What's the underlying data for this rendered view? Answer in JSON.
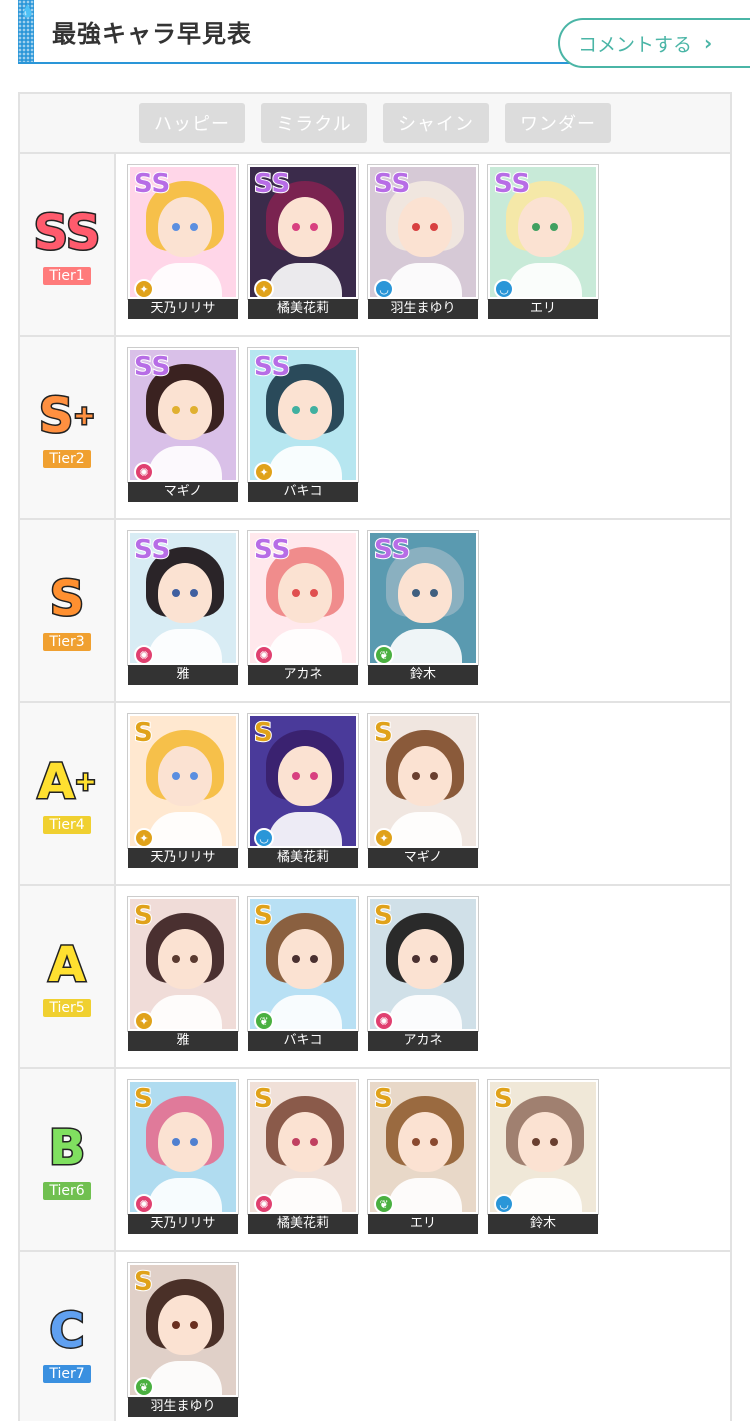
{
  "header": {
    "title": "最強キャラ早見表",
    "comment_label": "コメントする",
    "drop_glyph": "💧"
  },
  "filters": [
    "ハッピー",
    "ミラクル",
    "シャイン",
    "ワンダー"
  ],
  "tiers": [
    {
      "letter": "SS",
      "plus": "",
      "tier_label": "Tier1",
      "letter_color": "#ff5b6d",
      "badge_color": "#ff7b7b",
      "cards": [
        {
          "name": "天乃リリサ",
          "rarity": "SS",
          "attr": "happy",
          "attr_color": "#e0a21a",
          "hair": "#f6c04a",
          "eye": "#5b8fe0",
          "bg": "#ffd6e8"
        },
        {
          "name": "橘美花莉",
          "rarity": "SS",
          "attr": "happy",
          "attr_color": "#e0a21a",
          "hair": "#7a2350",
          "eye": "#d84080",
          "bg": "#3b2b4b"
        },
        {
          "name": "羽生まゆり",
          "rarity": "SS",
          "attr": "wonder",
          "attr_color": "#2a96d8",
          "hair": "#f0e6df",
          "eye": "#d84040",
          "bg": "#d6c9d6"
        },
        {
          "name": "エリ",
          "rarity": "SS",
          "attr": "wonder",
          "attr_color": "#2a96d8",
          "hair": "#f5e8a8",
          "eye": "#40a060",
          "bg": "#c8ead8"
        }
      ]
    },
    {
      "letter": "S",
      "plus": "+",
      "tier_label": "Tier2",
      "letter_color": "#ff9040",
      "badge_color": "#f0a030",
      "cards": [
        {
          "name": "マギノ",
          "rarity": "SS",
          "attr": "miracle",
          "attr_color": "#e04070",
          "hair": "#3a2220",
          "eye": "#e0b030",
          "bg": "#d9c0e8"
        },
        {
          "name": "バキコ",
          "rarity": "SS",
          "attr": "happy",
          "attr_color": "#e0a21a",
          "hair": "#2a4a5a",
          "eye": "#40b0a0",
          "bg": "#b6e6f0"
        }
      ]
    },
    {
      "letter": "S",
      "plus": "",
      "tier_label": "Tier3",
      "letter_color": "#ff9030",
      "badge_color": "#f0a030",
      "cards": [
        {
          "name": "雅",
          "rarity": "SS",
          "attr": "miracle",
          "attr_color": "#e04070",
          "hair": "#2a2428",
          "eye": "#4060a0",
          "bg": "#d8ecf4"
        },
        {
          "name": "アカネ",
          "rarity": "SS",
          "attr": "miracle",
          "attr_color": "#e04070",
          "hair": "#f08c8c",
          "eye": "#e05050",
          "bg": "#ffe8ec"
        },
        {
          "name": "鈴木",
          "rarity": "SS",
          "attr": "shine",
          "attr_color": "#4ab040",
          "hair": "#8ab0c0",
          "eye": "#406080",
          "bg": "#5a9ab0"
        }
      ]
    },
    {
      "letter": "A",
      "plus": "+",
      "tier_label": "Tier4",
      "letter_color": "#ffe030",
      "badge_color": "#f0d030",
      "cards": [
        {
          "name": "天乃リリサ",
          "rarity": "S",
          "attr": "happy",
          "attr_color": "#e0a21a",
          "hair": "#f6c04a",
          "eye": "#5b8fe0",
          "bg": "#ffe8d0"
        },
        {
          "name": "橘美花莉",
          "rarity": "S",
          "attr": "wonder",
          "attr_color": "#2a96d8",
          "hair": "#3a2270",
          "eye": "#d84080",
          "bg": "#4a3a9a"
        },
        {
          "name": "マギノ",
          "rarity": "S",
          "attr": "happy",
          "attr_color": "#e0a21a",
          "hair": "#8a5a3a",
          "eye": "#6a4030",
          "bg": "#f0e6e0"
        }
      ]
    },
    {
      "letter": "A",
      "plus": "",
      "tier_label": "Tier5",
      "letter_color": "#ffe030",
      "badge_color": "#f0d030",
      "cards": [
        {
          "name": "雅",
          "rarity": "S",
          "attr": "happy",
          "attr_color": "#e0a21a",
          "hair": "#4a3030",
          "eye": "#5a3a30",
          "bg": "#f0dcd8"
        },
        {
          "name": "バキコ",
          "rarity": "S",
          "attr": "shine",
          "attr_color": "#4ab040",
          "hair": "#8a6040",
          "eye": "#4a3030",
          "bg": "#b8e0f4"
        },
        {
          "name": "アカネ",
          "rarity": "S",
          "attr": "miracle",
          "attr_color": "#e04070",
          "hair": "#2a2a2a",
          "eye": "#4a3030",
          "bg": "#d0e0e8"
        }
      ]
    },
    {
      "letter": "B",
      "plus": "",
      "tier_label": "Tier6",
      "letter_color": "#80e060",
      "badge_color": "#70c050",
      "cards": [
        {
          "name": "天乃リリサ",
          "rarity": "S",
          "attr": "miracle",
          "attr_color": "#e04070",
          "hair": "#e07a9a",
          "eye": "#5080d0",
          "bg": "#b0dcf0"
        },
        {
          "name": "橘美花莉",
          "rarity": "S",
          "attr": "miracle",
          "attr_color": "#e04070",
          "hair": "#8a5a4a",
          "eye": "#c04060",
          "bg": "#f0e0d8"
        },
        {
          "name": "エリ",
          "rarity": "S",
          "attr": "shine",
          "attr_color": "#4ab040",
          "hair": "#9a6a40",
          "eye": "#8a4a30",
          "bg": "#e8d8c8"
        },
        {
          "name": "鈴木",
          "rarity": "S",
          "attr": "wonder",
          "attr_color": "#2a96d8",
          "hair": "#a08070",
          "eye": "#6a4030",
          "bg": "#f0e8d8"
        }
      ]
    },
    {
      "letter": "C",
      "plus": "",
      "tier_label": "Tier7",
      "letter_color": "#60a0f0",
      "badge_color": "#3a90e0",
      "cards": [
        {
          "name": "羽生まゆり",
          "rarity": "S",
          "attr": "shine",
          "attr_color": "#4ab040",
          "hair": "#4a3028",
          "eye": "#6a3020",
          "bg": "#e0d0c8"
        }
      ]
    }
  ]
}
